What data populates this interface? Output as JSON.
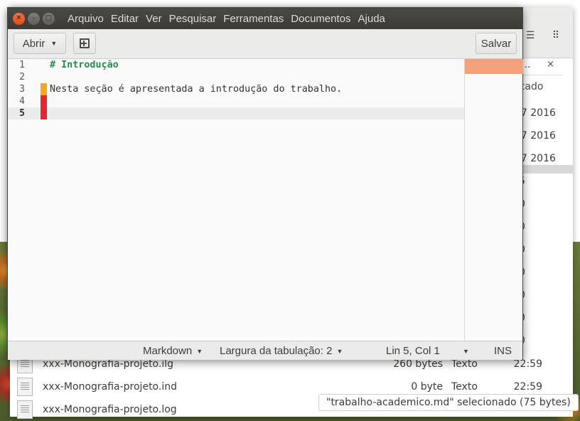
{
  "editor": {
    "menu": [
      "Arquivo",
      "Editar",
      "Ver",
      "Pesquisar",
      "Ferramentas",
      "Documentos",
      "Ajuda"
    ],
    "toolbar": {
      "open_label": "Abrir",
      "save_label": "Salvar"
    },
    "lines": [
      {
        "number": "1",
        "text": "# Introdução",
        "style": "heading",
        "mark": "none"
      },
      {
        "number": "2",
        "text": "",
        "style": "normal",
        "mark": "none"
      },
      {
        "number": "3",
        "text": "Nesta seção é apresentada a introdução do trabalho.",
        "style": "normal",
        "mark": "changed"
      },
      {
        "number": "4",
        "text": "",
        "style": "normal",
        "mark": "added"
      },
      {
        "number": "5",
        "text": "",
        "style": "normal",
        "mark": "added"
      }
    ],
    "status": {
      "language": "Markdown",
      "tab_width": "Largura da tabulação: 2",
      "position": "Lin 5, Col 1",
      "mode": "INS"
    },
    "colors": {
      "mark_changed": "#f5a623",
      "mark_added": "#e8262b",
      "heading": "#2a8a4a",
      "minimap_view": "#f5a07a",
      "close_button": "#df4a16"
    }
  },
  "file_manager": {
    "tab_label": "is...",
    "column_header": "ificado",
    "dates": [
      "27 2016",
      "27 2016",
      "27 2016"
    ],
    "partial_digits": [
      "5",
      "0",
      "0",
      "0",
      "0",
      "0",
      "0",
      "0"
    ],
    "rows": [
      {
        "name": "xxx-Monografia-projeto.ilg",
        "size": "260 bytes",
        "type": "Texto",
        "time": "22:59"
      },
      {
        "name": "xxx-Monografia-projeto.ind",
        "size": "0 byte",
        "type": "Texto",
        "time": "22:59"
      },
      {
        "name": "xxx-Monografia-projeto.log",
        "size": "",
        "type": "",
        "time": ""
      }
    ],
    "status_text": "\"trabalho-academico.md\" selecionado  (75 bytes)"
  }
}
